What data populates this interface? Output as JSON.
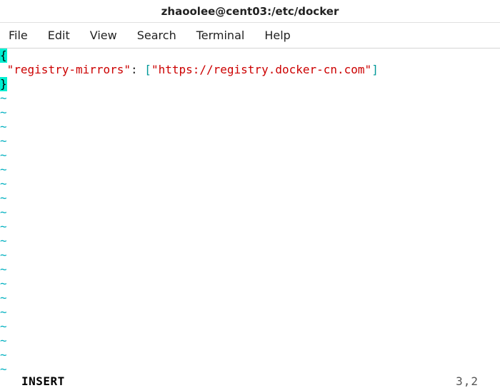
{
  "window": {
    "title": "zhaoolee@cent03:/etc/docker"
  },
  "menu": {
    "file": "File",
    "edit": "Edit",
    "view": "View",
    "search": "Search",
    "terminal": "Terminal",
    "help": "Help"
  },
  "editor": {
    "line1_brace": "{",
    "line2_key": "\"registry-mirrors\"",
    "line2_colon": ": ",
    "line2_lbracket": "[",
    "line2_url": "\"https://registry.docker-cn.com\"",
    "line2_rbracket": "]",
    "line3_brace": "}",
    "tilde": "~"
  },
  "status": {
    "mode": "INSERT",
    "position": "3,2"
  }
}
